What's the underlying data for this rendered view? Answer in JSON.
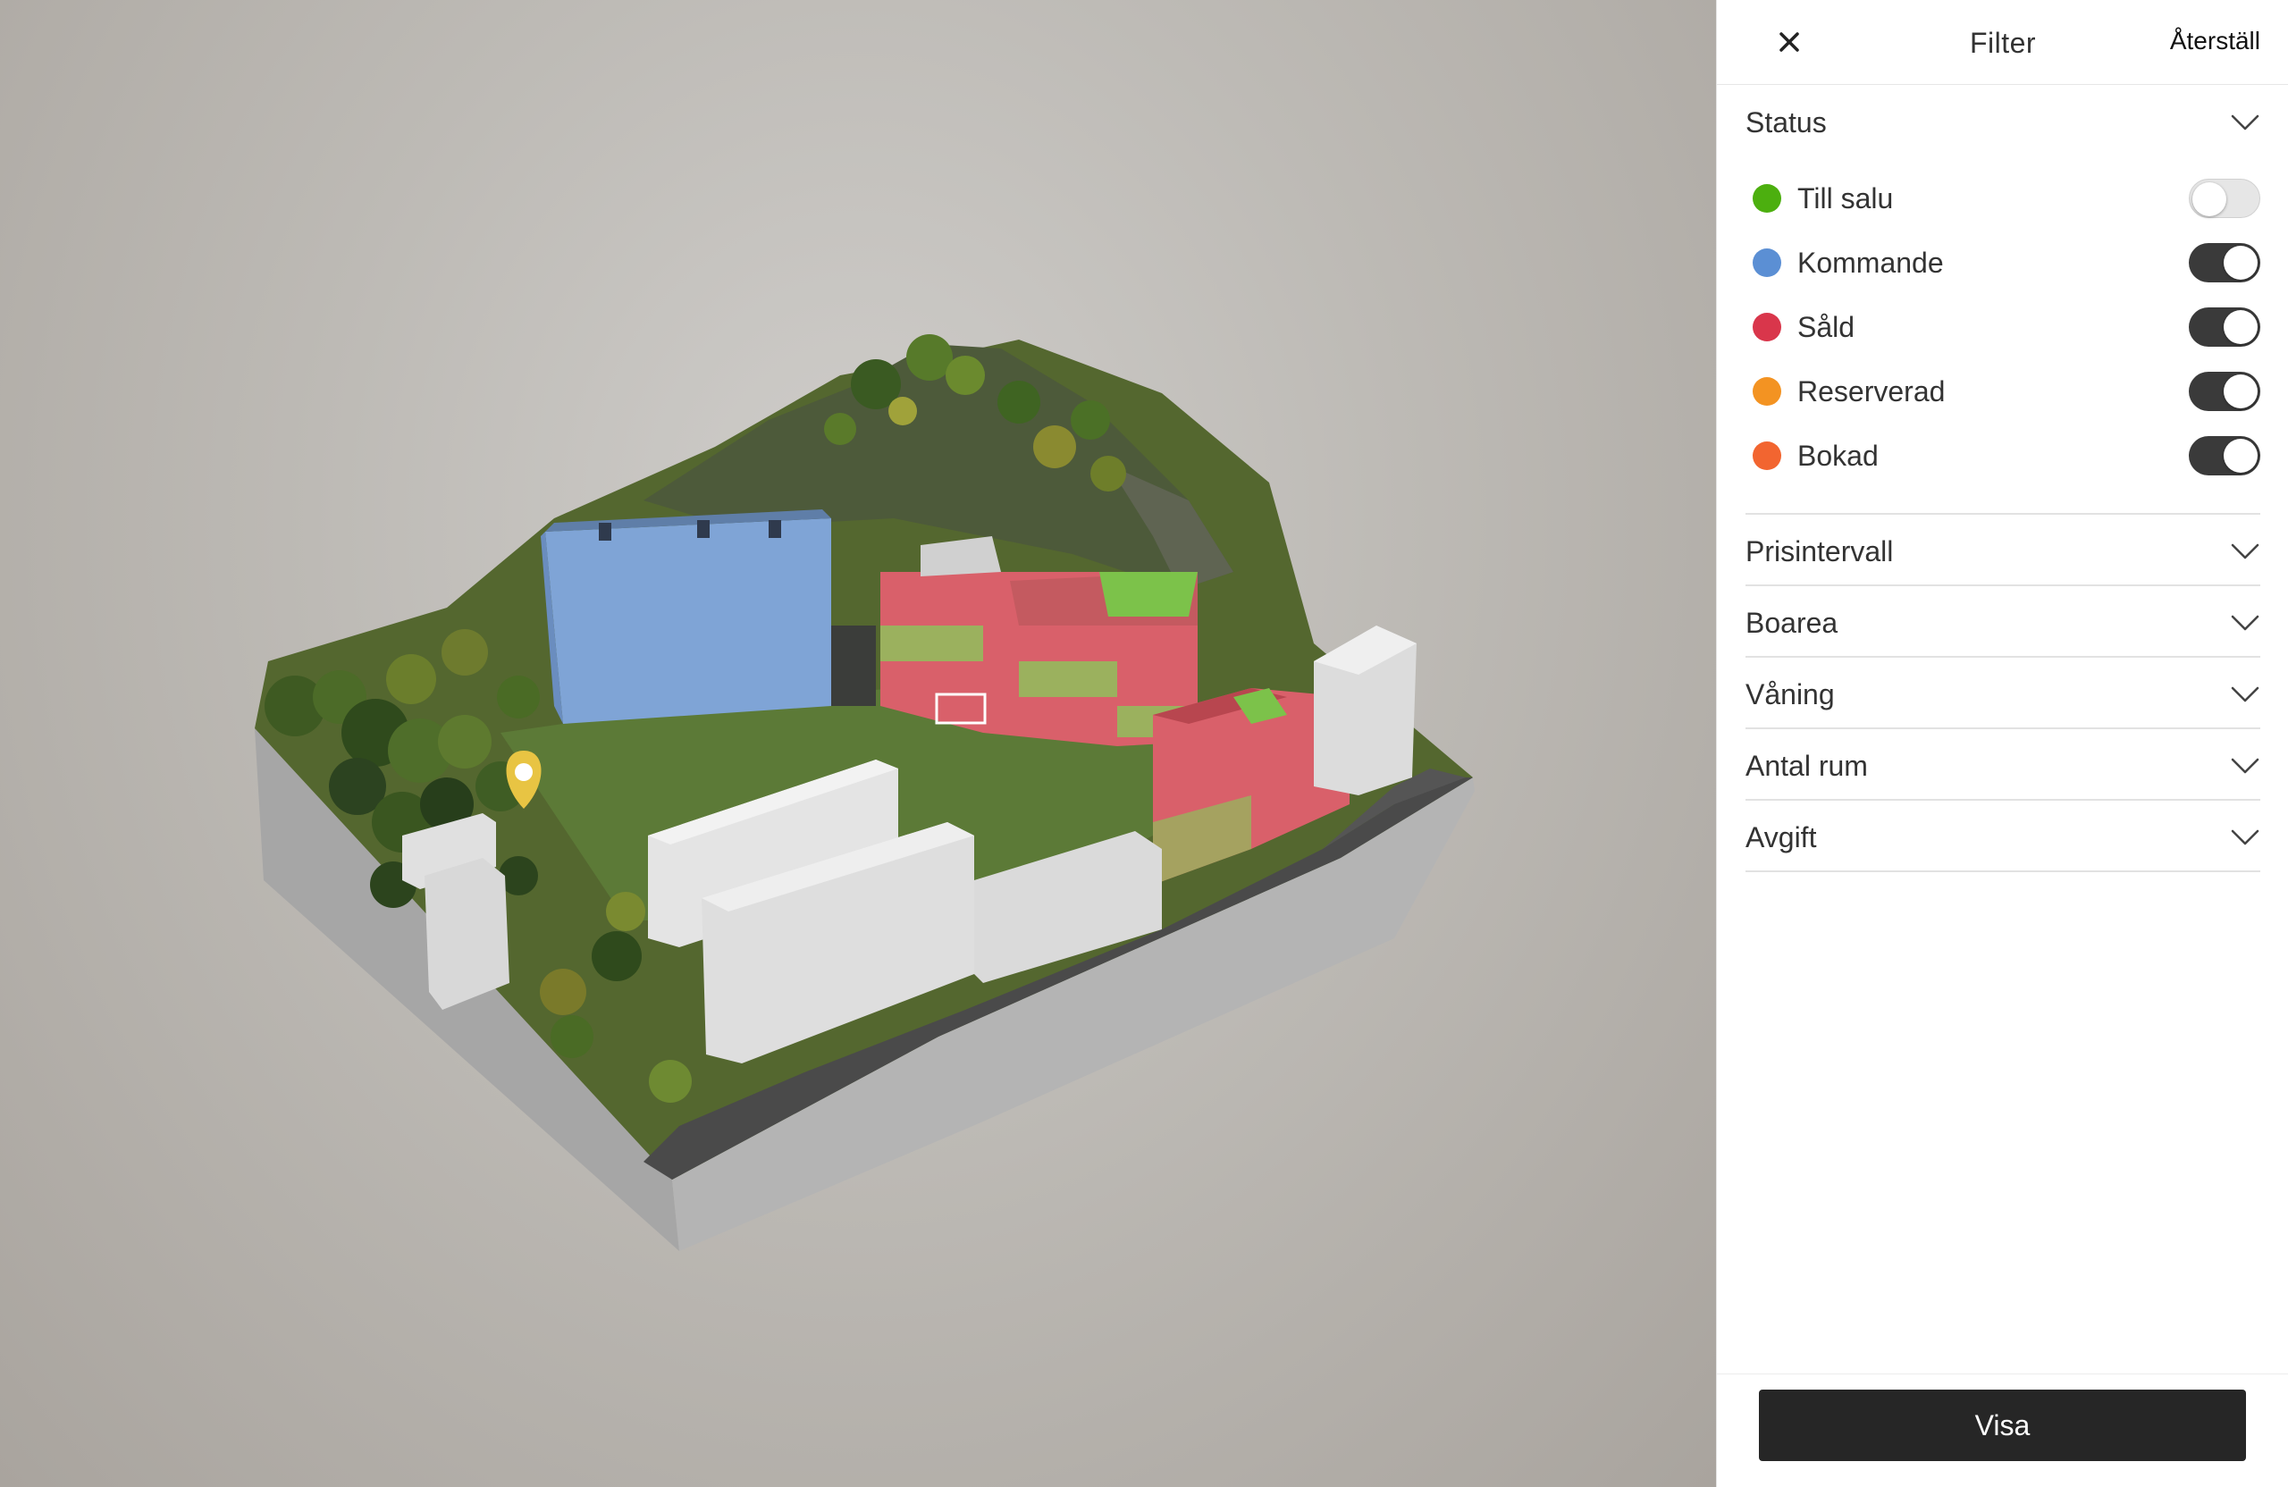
{
  "panel": {
    "title": "Filter",
    "reset_label": "Återställ",
    "close_icon": "close-icon"
  },
  "status": {
    "label": "Status",
    "items": [
      {
        "label": "Till salu",
        "color": "#4caf0f",
        "enabled": false
      },
      {
        "label": "Kommande",
        "color": "#5b8fd4",
        "enabled": true
      },
      {
        "label": "Såld",
        "color": "#d9364b",
        "enabled": true
      },
      {
        "label": "Reserverad",
        "color": "#f39322",
        "enabled": true
      },
      {
        "label": "Bokad",
        "color": "#f26530",
        "enabled": true
      }
    ]
  },
  "filters": [
    {
      "label": "Prisintervall"
    },
    {
      "label": "Boarea"
    },
    {
      "label": "Våning"
    },
    {
      "label": "Antal rum"
    },
    {
      "label": "Avgift"
    }
  ],
  "footer": {
    "show_label": "Visa"
  },
  "colors": {
    "toggle_on": "#3a3a3a",
    "button_dark": "#262626",
    "building_upcoming": "#7fa4d6",
    "building_sold": "#d9606a",
    "building_for_sale": "#7cc24a",
    "poi_marker": "#e8c443"
  }
}
